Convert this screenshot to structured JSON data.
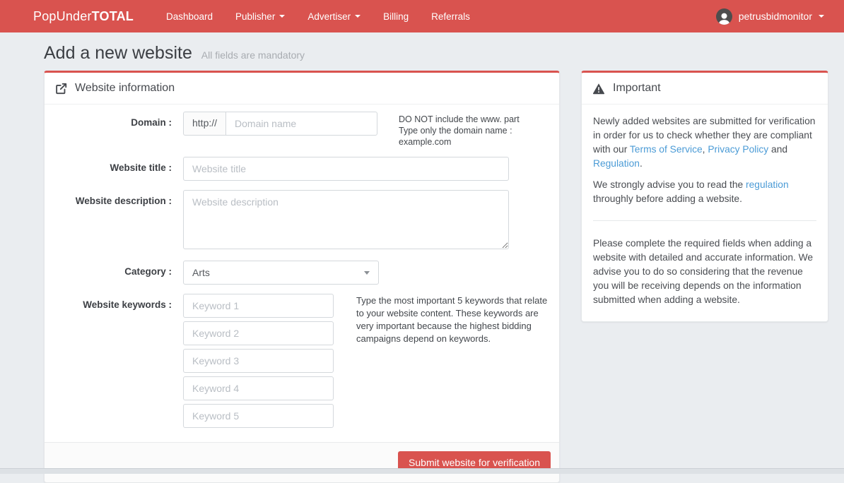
{
  "colors": {
    "accent": "#d9534f",
    "link": "#4b9bd6",
    "navbar_bg": "#d9534f",
    "page_bg": "#eaedf0"
  },
  "navbar": {
    "brand": {
      "prefix": "PopUnder",
      "suffix": "TOTAL"
    },
    "items": [
      {
        "label": "Dashboard",
        "dropdown": false
      },
      {
        "label": "Publisher",
        "dropdown": true
      },
      {
        "label": "Advertiser",
        "dropdown": true
      },
      {
        "label": "Billing",
        "dropdown": false
      },
      {
        "label": "Referrals",
        "dropdown": false
      }
    ],
    "user": {
      "name": "petrusbidmonitor"
    }
  },
  "page": {
    "title": "Add a new website",
    "subtitle": "All fields are mandatory"
  },
  "form_panel": {
    "title": "Website information",
    "fields": {
      "domain": {
        "label": "Domain :",
        "addon": "http://",
        "placeholder": "Domain name",
        "help_line1": "DO NOT include the www. part",
        "help_line2": "Type only the domain name : example.com"
      },
      "website_title": {
        "label": "Website title :",
        "placeholder": "Website title"
      },
      "description": {
        "label": "Website description :",
        "placeholder": "Website description"
      },
      "category": {
        "label": "Category :",
        "value": "Arts"
      },
      "keywords": {
        "label": "Website keywords :",
        "placeholders": [
          "Keyword 1",
          "Keyword 2",
          "Keyword 3",
          "Keyword 4",
          "Keyword 5"
        ],
        "help": "Type the most important 5 keywords that relate to your website content. These keywords are very important because the highest bidding campaigns depend on keywords."
      }
    },
    "submit_label": "Submit website for verification"
  },
  "important_panel": {
    "title": "Important",
    "p1": {
      "parts": [
        {
          "type": "text",
          "text": "Newly added websites are submitted for verification in order for us to check whether they are compliant with our "
        },
        {
          "type": "link",
          "text": "Terms of Service"
        },
        {
          "type": "text",
          "text": ", "
        },
        {
          "type": "link",
          "text": "Privacy Policy"
        },
        {
          "type": "text",
          "text": " and "
        },
        {
          "type": "link",
          "text": "Regulation"
        },
        {
          "type": "text",
          "text": "."
        }
      ]
    },
    "p2": {
      "parts": [
        {
          "type": "text",
          "text": "We strongly advise you to read the "
        },
        {
          "type": "link",
          "text": "regulation"
        },
        {
          "type": "text",
          "text": " throughly before adding a website."
        }
      ]
    },
    "p3": "Please complete the required fields when adding a website with detailed and accurate information. We advise you to do so considering that the revenue you will be receiving depends on the information submitted when adding a website."
  }
}
